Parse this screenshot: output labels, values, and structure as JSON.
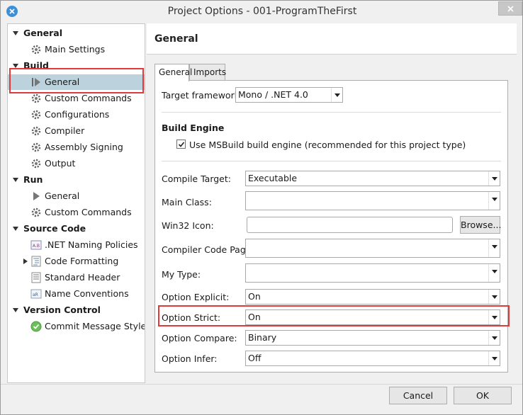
{
  "window": {
    "title": "Project Options - 001-ProgramTheFirst"
  },
  "sidebar": {
    "items": [
      {
        "label": "General",
        "kind": "header"
      },
      {
        "label": "Main Settings",
        "icon": "gear-icon"
      },
      {
        "label": "Build",
        "kind": "header"
      },
      {
        "label": "General",
        "icon": "play-icon",
        "selected": true
      },
      {
        "label": "Custom Commands",
        "icon": "gear-icon"
      },
      {
        "label": "Configurations",
        "icon": "gear-icon"
      },
      {
        "label": "Compiler",
        "icon": "gear-icon"
      },
      {
        "label": "Assembly Signing",
        "icon": "gear-icon"
      },
      {
        "label": "Output",
        "icon": "gear-icon"
      },
      {
        "label": "Run",
        "kind": "header"
      },
      {
        "label": "General",
        "icon": "play-icon"
      },
      {
        "label": "Custom Commands",
        "icon": "gear-icon"
      },
      {
        "label": "Source Code",
        "kind": "header"
      },
      {
        "label": ".NET Naming Policies",
        "icon": "naming-policy-icon"
      },
      {
        "label": "Code Formatting",
        "icon": "code-formatting-icon"
      },
      {
        "label": "Standard Header",
        "icon": "document-icon"
      },
      {
        "label": "Name Conventions",
        "icon": "name-conventions-icon"
      },
      {
        "label": "Version Control",
        "kind": "header"
      },
      {
        "label": "Commit Message Style",
        "icon": "check-circle-icon"
      }
    ]
  },
  "main": {
    "header": "General",
    "tabs": [
      {
        "label": "General",
        "active": true
      },
      {
        "label": "Imports"
      }
    ],
    "target_framework": {
      "label": "Target framework:",
      "value": "Mono / .NET 4.0"
    },
    "build_engine": {
      "title": "Build Engine",
      "checkbox_label": "Use MSBuild build engine (recommended for this project type)",
      "checked": true
    },
    "compile_target": {
      "label": "Compile Target:",
      "value": "Executable"
    },
    "main_class": {
      "label": "Main Class:",
      "value": ""
    },
    "win32_icon": {
      "label": "Win32 Icon:",
      "value": "",
      "browse_label": "Browse..."
    },
    "compiler_code_page": {
      "label": "Compiler Code Page:",
      "value": ""
    },
    "my_type": {
      "label": "My Type:",
      "value": ""
    },
    "option_explicit": {
      "label": "Option Explicit:",
      "value": "On"
    },
    "option_strict": {
      "label": "Option Strict:",
      "value": "On"
    },
    "option_compare": {
      "label": "Option Compare:",
      "value": "Binary"
    },
    "option_infer": {
      "label": "Option Infer:",
      "value": "Off"
    }
  },
  "footer": {
    "cancel_label": "Cancel",
    "ok_label": "OK"
  },
  "colors": {
    "highlight": "#e03a3a",
    "selected_row": "#bcd3dd"
  }
}
